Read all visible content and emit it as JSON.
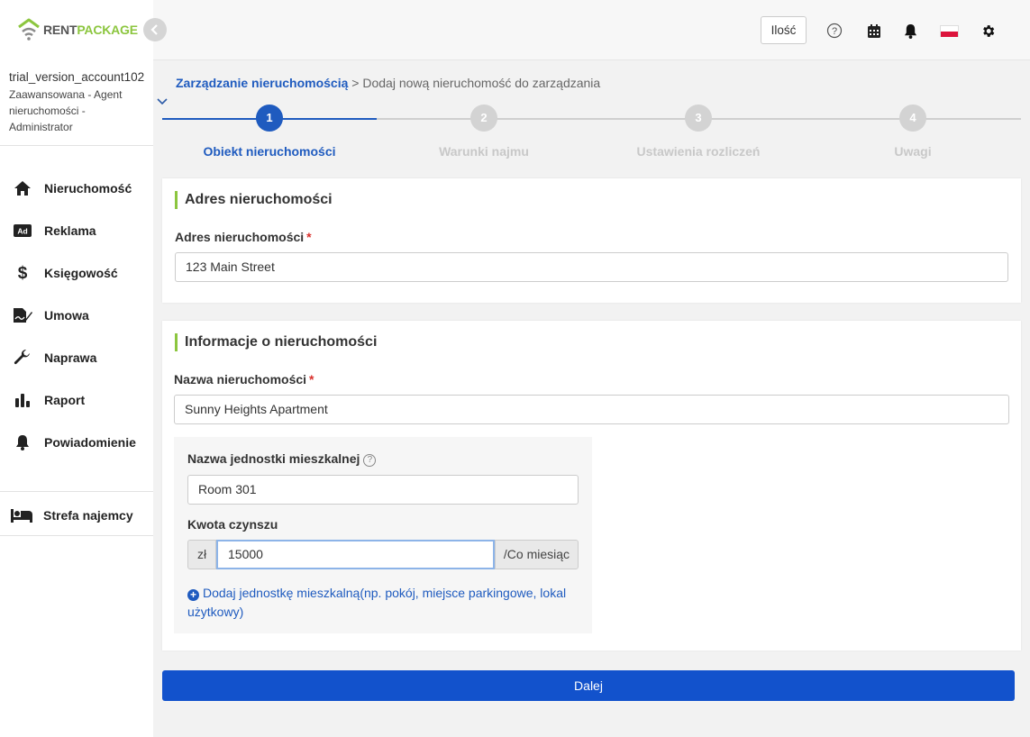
{
  "brand": {
    "rent": "RENT",
    "package": "PACKAGE"
  },
  "account": {
    "name": "trial_version_account102",
    "role": "Zaawansowana - Agent nieruchomości - Administrator"
  },
  "sidebar": {
    "items": [
      {
        "label": "Nieruchomość",
        "icon": "home-icon"
      },
      {
        "label": "Reklama",
        "icon": "ad-icon"
      },
      {
        "label": "Księgowość",
        "icon": "dollar-icon"
      },
      {
        "label": "Umowa",
        "icon": "contract-icon"
      },
      {
        "label": "Naprawa",
        "icon": "wrench-icon"
      },
      {
        "label": "Raport",
        "icon": "bar-chart-icon"
      },
      {
        "label": "Powiadomienie",
        "icon": "bell-icon"
      }
    ],
    "tenant_label": "Strefa najemcy"
  },
  "header": {
    "quantity_label": "Ilość"
  },
  "breadcrumb": {
    "parent": "Zarządzanie nieruchomością",
    "separator": " > ",
    "current": "Dodaj nową nieruchomość do zarządzania"
  },
  "stepper": {
    "steps": [
      {
        "number": "1",
        "label": "Obiekt nieruchomości",
        "active": true
      },
      {
        "number": "2",
        "label": "Warunki najmu",
        "active": false
      },
      {
        "number": "3",
        "label": "Ustawienia rozliczeń",
        "active": false
      },
      {
        "number": "4",
        "label": "Uwagi",
        "active": false
      }
    ],
    "active_color": "#1f5bbf",
    "inactive_color": "#d3d3d3"
  },
  "address_section": {
    "title": "Adres nieruchomości",
    "label": "Adres nieruchomości",
    "required_mark": "*",
    "value": "123 Main Street"
  },
  "info_section": {
    "title": "Informacje o nieruchomości",
    "name_label": "Nazwa nieruchomości",
    "required_mark": "*",
    "name_value": "Sunny Heights Apartment",
    "unit": {
      "name_label": "Nazwa jednostki mieszkalnej",
      "help_icon": "?",
      "name_value": "Room 301",
      "rent_label": "Kwota czynszu",
      "currency": "zł",
      "rent_value": "15000",
      "period": "/Co miesiąc",
      "add_plus": "+",
      "add_link": "Dodaj jednostkę mieszkalną(np. pokój, miejsce parkingowe, lokal użytkowy)"
    }
  },
  "next_button": "Dalej",
  "colors": {
    "accent_green": "#8cc63f",
    "primary_blue": "#1252cc",
    "link_blue": "#1f5bbf"
  }
}
